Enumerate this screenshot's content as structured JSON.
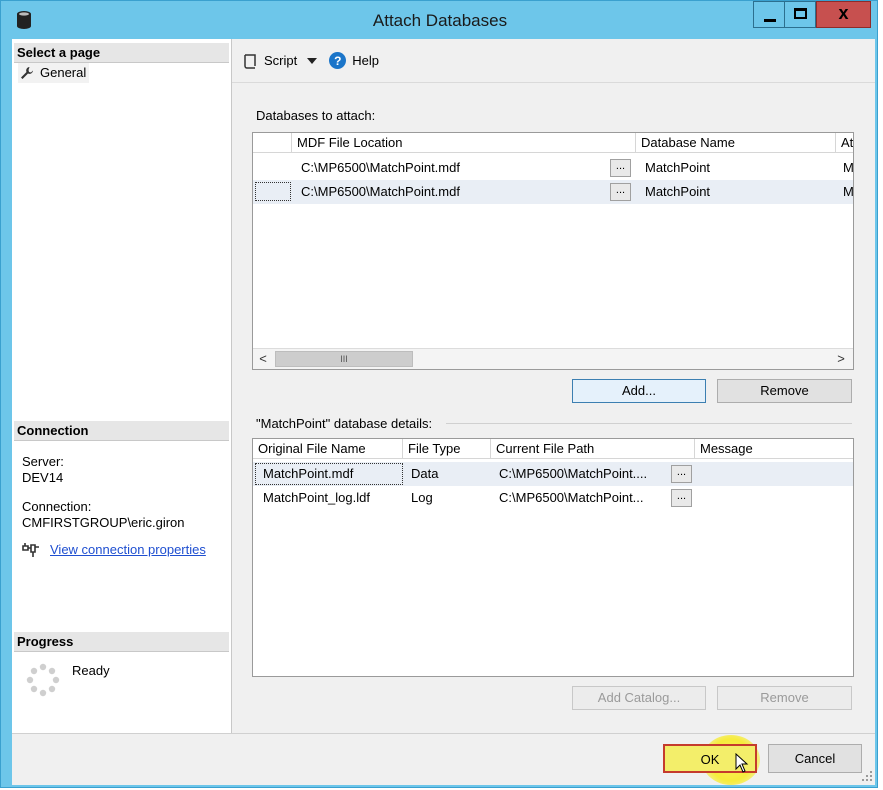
{
  "window": {
    "title": "Attach Databases",
    "close_glyph": "x",
    "accent_color": "#6dc6ea",
    "close_color": "#c7504f"
  },
  "left_pane": {
    "select_page_header": "Select a page",
    "pages": [
      {
        "label": "General",
        "icon": "wrench-icon"
      }
    ],
    "connection_header": "Connection",
    "server_label": "Server:",
    "server_value": "DEV14",
    "connection_label": "Connection:",
    "connection_value": "CMFIRSTGROUP\\eric.giron",
    "view_properties_link": "View connection properties",
    "progress_header": "Progress",
    "progress_status": "Ready"
  },
  "toolbar": {
    "script_label": "Script",
    "help_label": "Help",
    "help_glyph": "?"
  },
  "databases": {
    "label": "Databases to attach:",
    "columns": [
      "MDF File Location",
      "Database Name",
      "At"
    ],
    "rows": [
      {
        "mdf": "C:\\MP6500\\MatchPoint.mdf",
        "db": "MatchPoint",
        "extra": "M"
      },
      {
        "mdf": "C:\\MP6500\\MatchPoint.mdf",
        "db": "MatchPoint",
        "extra": "M"
      }
    ],
    "ellipsis": "...",
    "scroll_left": "<",
    "scroll_right": ">",
    "scroll_thumb": "III",
    "add_button": "Add...",
    "remove_button": "Remove"
  },
  "details": {
    "label": "\"MatchPoint\" database details:",
    "columns": [
      "Original File Name",
      "File Type",
      "Current File Path",
      "Message"
    ],
    "rows": [
      {
        "name": "MatchPoint.mdf",
        "type": "Data",
        "path": "C:\\MP6500\\MatchPoint...."
      },
      {
        "name": "MatchPoint_log.ldf",
        "type": "Log",
        "path": "C:\\MP6500\\MatchPoint..."
      }
    ],
    "ellipsis": "...",
    "add_catalog_button": "Add Catalog...",
    "remove_button": "Remove"
  },
  "footer": {
    "ok_button": "OK",
    "cancel_button": "Cancel"
  }
}
